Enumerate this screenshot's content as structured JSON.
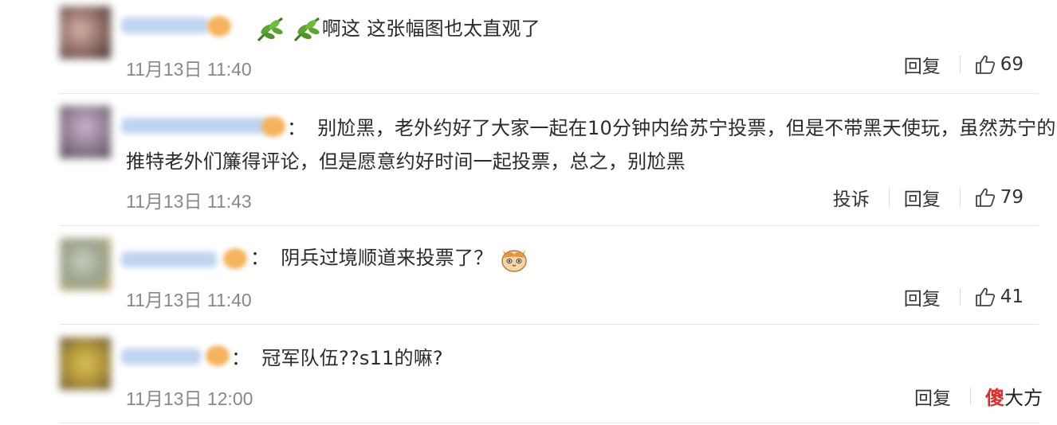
{
  "comments": [
    {
      "text": "啊这 这张幅图也太直观了",
      "time": "11月13日 11:40",
      "reply_label": "回复",
      "likes": "69",
      "emoji_before": [
        "leaf-emoji",
        "leaf-emoji"
      ]
    },
    {
      "colon": "：",
      "text_line1": "别尬黑，老外约好了大家一起在10分钟内给苏宁投票，但是不带黑天使玩，虽然苏宁的",
      "text_line2": "推特老外们簾得评论，但是愿意约好时间一起投票，总之，别尬黑",
      "time": "11月13日 11:43",
      "report_label": "投诉",
      "reply_label": "回复",
      "likes": "79"
    },
    {
      "colon": "：",
      "text": "阴兵过境顺道来投票了？",
      "time": "11月13日 11:40",
      "reply_label": "回复",
      "likes": "41",
      "emoji_after": "cat-emoji"
    },
    {
      "colon": "：",
      "text": "冠军队伍??s11的嘛?",
      "time": "11月13日 12:00",
      "reply_label": "回复"
    }
  ],
  "watermark": {
    "red_char": "傻",
    "rest": "大方"
  },
  "colors": {
    "text": "#2b2b2b",
    "time": "#888888",
    "divider": "#e6e6e6"
  }
}
